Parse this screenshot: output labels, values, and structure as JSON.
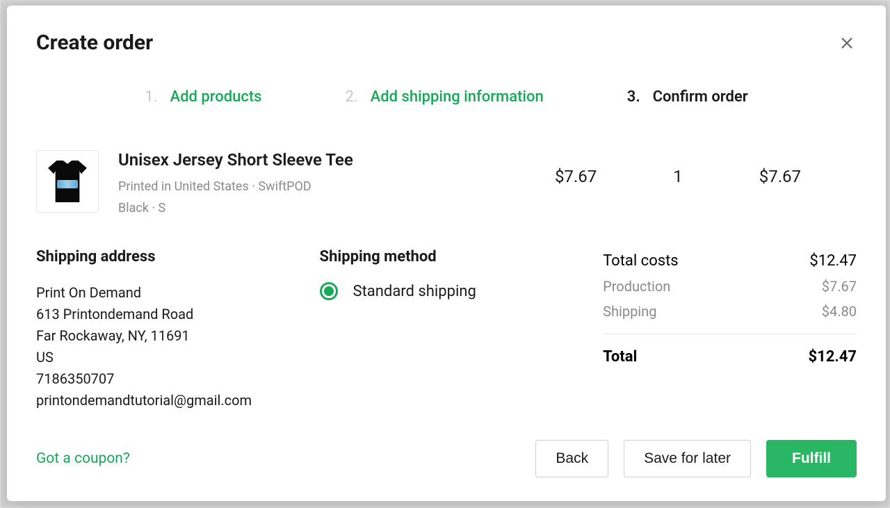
{
  "modal": {
    "title": "Create order"
  },
  "steps": [
    {
      "num": "1.",
      "label": "Add products"
    },
    {
      "num": "2.",
      "label": "Add shipping information"
    },
    {
      "num": "3.",
      "label": "Confirm order"
    }
  ],
  "product": {
    "name": "Unisex Jersey Short Sleeve Tee",
    "meta1": "Printed in United States · SwiftPOD",
    "meta2": "Black · S",
    "unit_price": "$7.67",
    "qty": "1",
    "line_total": "$7.67"
  },
  "shipping_address": {
    "heading": "Shipping address",
    "name": "Print On Demand",
    "street": "613 Printondemand Road",
    "city": "Far Rockaway, NY, 11691",
    "country": "US",
    "phone": "7186350707",
    "email": "printondemandtutorial@gmail.com"
  },
  "shipping_method": {
    "heading": "Shipping method",
    "option": "Standard shipping"
  },
  "costs": {
    "total_costs_label": "Total costs",
    "total_costs_value": "$12.47",
    "production_label": "Production",
    "production_value": "$7.67",
    "shipping_label": "Shipping",
    "shipping_value": "$4.80",
    "total_label": "Total",
    "total_value": "$12.47"
  },
  "footer": {
    "coupon": "Got a coupon?",
    "back": "Back",
    "save": "Save for later",
    "fulfill": "Fulfill"
  }
}
